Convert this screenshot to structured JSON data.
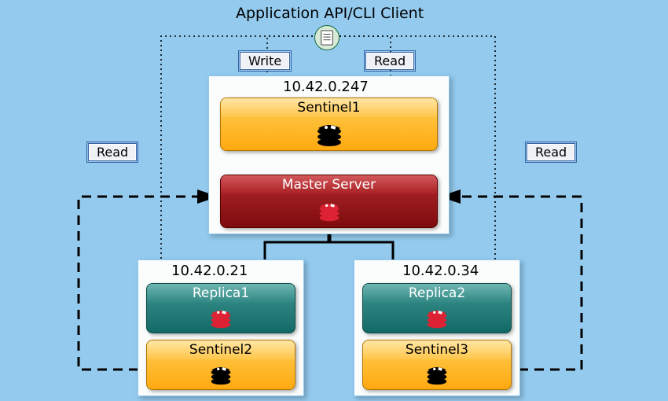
{
  "client_title": "Application API/CLI Client",
  "labels": {
    "write": "Write",
    "read_top": "Read",
    "read_left": "Read",
    "read_right": "Read"
  },
  "master_panel": {
    "ip": "10.42.0.247",
    "sentinel_name": "Sentinel1",
    "master_name": "Master Server"
  },
  "replica_left": {
    "ip": "10.42.0.21",
    "replica_name": "Replica1",
    "sentinel_name": "Sentinel2"
  },
  "replica_right": {
    "ip": "10.42.0.34",
    "replica_name": "Replica2",
    "sentinel_name": "Sentinel3"
  },
  "colors": {
    "bg": "#93caee",
    "orange": "#ffb728",
    "teal": "#1f7975",
    "red": "#8a1113"
  },
  "icons": {
    "client": "document-icon",
    "sentinel": "redis-icon-black",
    "replica": "redis-icon-red",
    "master": "redis-icon-darkred"
  },
  "chart_data": {
    "type": "diagram",
    "title": "Redis Sentinel high-availability topology",
    "nodes": [
      {
        "id": "client",
        "label": "Application API/CLI Client",
        "kind": "client"
      },
      {
        "id": "sentinel1",
        "label": "Sentinel1",
        "kind": "sentinel",
        "host_ip": "10.42.0.247"
      },
      {
        "id": "master",
        "label": "Master Server",
        "kind": "master",
        "host_ip": "10.42.0.247"
      },
      {
        "id": "replica1",
        "label": "Replica1",
        "kind": "replica",
        "host_ip": "10.42.0.21"
      },
      {
        "id": "sentinel2",
        "label": "Sentinel2",
        "kind": "sentinel",
        "host_ip": "10.42.0.21"
      },
      {
        "id": "replica2",
        "label": "Replica2",
        "kind": "replica",
        "host_ip": "10.42.0.34"
      },
      {
        "id": "sentinel3",
        "label": "Sentinel3",
        "kind": "sentinel",
        "host_ip": "10.42.0.34"
      }
    ],
    "groups": [
      {
        "ip": "10.42.0.247",
        "members": [
          "sentinel1",
          "master"
        ]
      },
      {
        "ip": "10.42.0.21",
        "members": [
          "replica1",
          "sentinel2"
        ]
      },
      {
        "ip": "10.42.0.34",
        "members": [
          "replica2",
          "sentinel3"
        ]
      }
    ],
    "edges": [
      {
        "from": "client",
        "to": "master",
        "label": "Write",
        "style": "dotted",
        "directed": true
      },
      {
        "from": "client",
        "to": "master",
        "label": "Read",
        "style": "dotted",
        "directed": true
      },
      {
        "from": "client",
        "to": "replica1",
        "label": "Read",
        "style": "dotted",
        "directed": true
      },
      {
        "from": "client",
        "to": "replica2",
        "label": "Read",
        "style": "dotted",
        "directed": true
      },
      {
        "from": "sentinel1",
        "to": "master",
        "style": "solid",
        "directed": true
      },
      {
        "from": "master",
        "to": "replica1",
        "style": "solid",
        "directed": true
      },
      {
        "from": "master",
        "to": "replica2",
        "style": "solid",
        "directed": true
      },
      {
        "from": "sentinel2",
        "to": "master",
        "style": "dashed",
        "directed": true
      },
      {
        "from": "sentinel3",
        "to": "master",
        "style": "dashed",
        "directed": true
      }
    ]
  }
}
